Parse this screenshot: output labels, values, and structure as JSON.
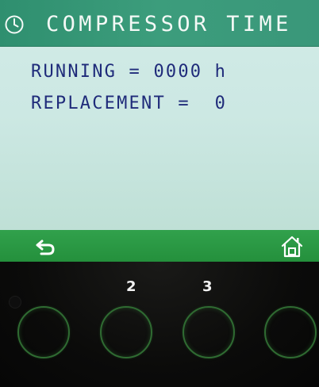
{
  "header": {
    "title": "COMPRESSOR TIME",
    "icon": "clock-icon",
    "bg_color": "#3a977a",
    "text_color": "#f4f9f6"
  },
  "content": {
    "running_line": "RUNNING = 0000 h",
    "replacement_line": "REPLACEMENT =  0",
    "text_color": "#1f2b7a"
  },
  "footer": {
    "back_icon": "back-arrow-icon",
    "home_icon": "home-icon",
    "bg_color": "#2a9844"
  },
  "hardware_buttons": {
    "labels": [
      "2",
      "3"
    ],
    "ring_color": "#2f6b32"
  }
}
